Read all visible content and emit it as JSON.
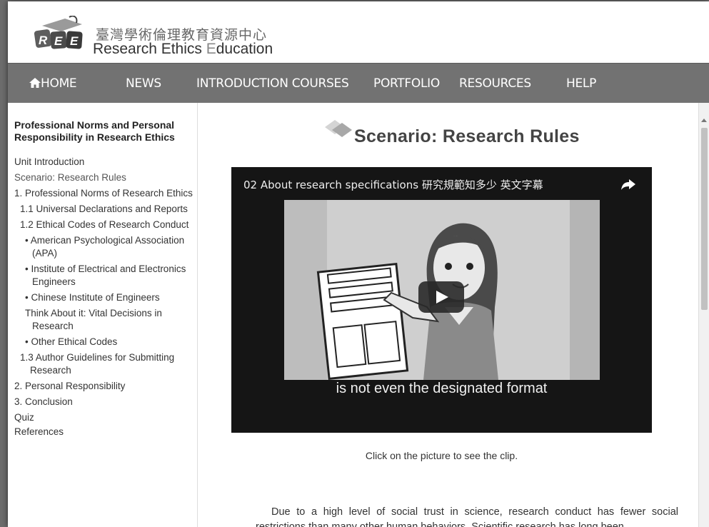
{
  "header": {
    "site_name_cn": "臺灣學術倫理教育資源中心",
    "site_name_en_parts": [
      "Research Ethics ",
      "E",
      "ducation"
    ],
    "logo_text": "REE"
  },
  "nav": {
    "items": [
      {
        "label": "HOME",
        "icon": "home-icon"
      },
      {
        "label": "NEWS"
      },
      {
        "label": "INTRODUCTION COURSES"
      },
      {
        "label": "PORTFOLIO"
      },
      {
        "label": "RESOURCES"
      },
      {
        "label": "HELP"
      }
    ]
  },
  "sidebar": {
    "title": "Professional Norms and Personal Responsibility in Research Ethics",
    "items": [
      {
        "label": "Unit Introduction"
      },
      {
        "label": "Scenario: Research Rules"
      },
      {
        "label": "1. Professional Norms of Research Ethics"
      },
      {
        "label": "1.1 Universal Declarations and Reports"
      },
      {
        "label": "1.2 Ethical Codes of Research Conduct"
      },
      {
        "label": "• American Psychological Association (APA)"
      },
      {
        "label": "• Institute of Electrical and Electronics Engineers"
      },
      {
        "label": "• Chinese Institute of Engineers"
      },
      {
        "label": "Think About it: Vital Decisions in Research"
      },
      {
        "label": "• Other Ethical Codes"
      },
      {
        "label": "1.3 Author Guidelines for Submitting Research"
      },
      {
        "label": "2. Personal Responsibility"
      },
      {
        "label": "3. Conclusion"
      },
      {
        "label": "Quiz"
      },
      {
        "label": "References"
      }
    ]
  },
  "main": {
    "title": "Scenario: Research Rules",
    "video": {
      "title": "02 About research specifications 研究規範知多少 英文字幕",
      "subtitle": "is not even the designated format"
    },
    "caption": "Click on the picture to see the clip.",
    "body": "Due to a high level of social trust in science, research conduct has fewer social restrictions than many other human behaviors. Scientific research has long been"
  },
  "colors": {
    "nav_bg": "#727272",
    "video_bg": "#151515",
    "page_bg": "#ffffff"
  }
}
